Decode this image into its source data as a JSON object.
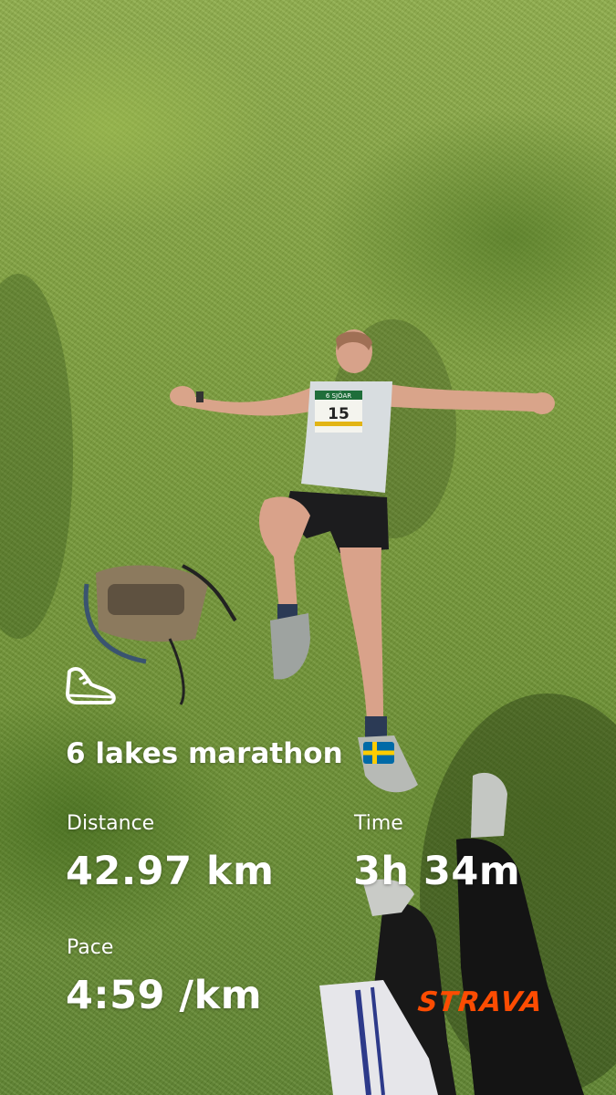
{
  "activity": {
    "title": "6 lakes marathon",
    "flag_icon": "sweden-flag-icon",
    "sport_icon": "running-shoe-icon"
  },
  "stats": {
    "distance_label": "Distance",
    "distance_value": "42.97 km",
    "time_label": "Time",
    "time_value": "3h 34m",
    "pace_label": "Pace",
    "pace_value": "4:59 /km"
  },
  "brand": {
    "name": "STRAVA",
    "color": "#fc4c02"
  },
  "photo": {
    "bib_number": "15",
    "bib_header": "6 SJÖAR"
  }
}
